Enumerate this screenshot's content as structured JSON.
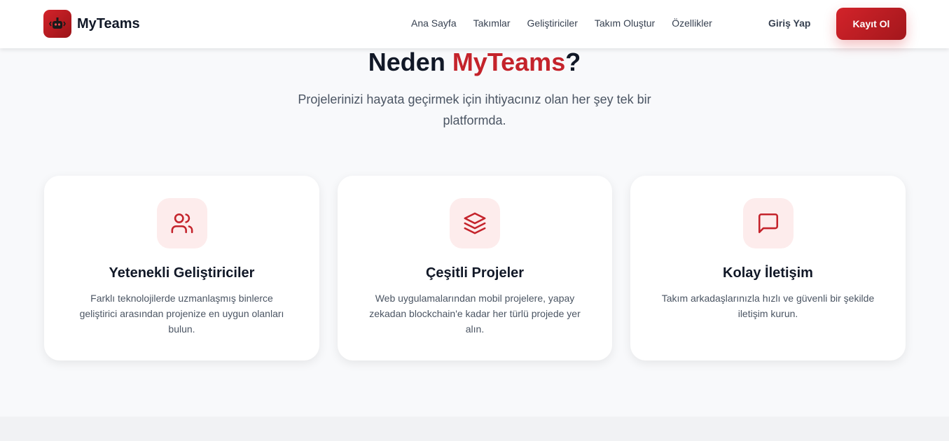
{
  "navbar": {
    "brand": {
      "name": "MyTeams",
      "logo_icon": "robot-icon"
    },
    "links": [
      {
        "label": "Ana Sayfa"
      },
      {
        "label": "Takımlar"
      },
      {
        "label": "Geliştiriciler"
      },
      {
        "label": "Takım Oluştur"
      },
      {
        "label": "Özellikler"
      }
    ],
    "login_label": "Giriş Yap",
    "signup_label": "Kayıt Ol"
  },
  "section": {
    "title_prefix": "Neden ",
    "title_accent": "MyTeams",
    "title_suffix": "?",
    "subtitle": "Projelerinizi hayata geçirmek için ihtiyacınız olan her şey tek bir platformda."
  },
  "features": [
    {
      "icon": "users-icon",
      "title": "Yetenekli Geliştiriciler",
      "text": "Farklı teknolojilerde uzmanlaşmış binlerce geliştirici arasından projenize en uygun olanları bulun."
    },
    {
      "icon": "layers-icon",
      "title": "Çeşitli Projeler",
      "text": "Web uygulamalarından mobil projelere, yapay zekadan blockchain'e kadar her türlü projede yer alın."
    },
    {
      "icon": "message-icon",
      "title": "Kolay İletişim",
      "text": "Takım arkadaşlarınızla hızlı ve güvenli bir şekilde iletişim kurun."
    }
  ],
  "colors": {
    "accent": "#c4232b",
    "accent_dark": "#9b1318",
    "icon_bg": "#fdecec",
    "page_bg": "#f8f9fb"
  }
}
